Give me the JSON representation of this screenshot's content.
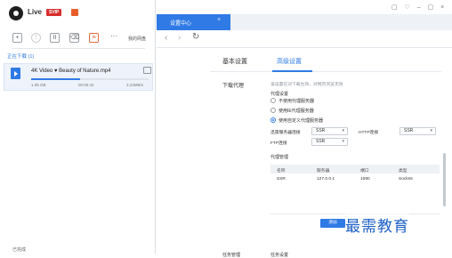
{
  "app": {
    "name": "Live",
    "badge": "SVIP"
  },
  "toolbar": {
    "more": "···",
    "my_downloads": "我的网盘"
  },
  "sidebar": {
    "downloading_tab": "正在下载 (1)",
    "completed_tab": "已完成",
    "task": {
      "name": "4K Video ♥ Beauty of Nature.mp4",
      "progress": 0.42,
      "size": "1.05 GB",
      "time": "00:05:42",
      "speed": "3.23MB/s"
    }
  },
  "browser": {
    "tab_title": "设置中心",
    "tab_close": "×",
    "win_ctrls": "▢ ♡ – ▢ ×"
  },
  "settings": {
    "tabs": [
      "基本设置",
      "高级设置"
    ],
    "active_tab": 1,
    "section_title": "下载代理",
    "section_desc": "该设置仅对下载生效，对网页浏览无效",
    "proxy_settings_label": "代理设置",
    "radio_options": [
      "不使用代理服务器",
      "使用IE代理服务器",
      "使用自定义代理服务器"
    ],
    "radio_selected": 2,
    "xunlei_label": "迅雷服务器连接",
    "xunlei_value": "SSR",
    "http_label": "HTTP连接",
    "http_value": "SSR",
    "ftp_label": "FTP连接",
    "ftp_value": "SSR",
    "mgmt_label": "代理管理",
    "table": {
      "columns": [
        "名称",
        "服务器",
        "端口",
        "类型"
      ],
      "rows": [
        [
          "SSR",
          "127.0.0.1",
          "1080",
          "Socks5"
        ]
      ]
    },
    "add_button": "添加",
    "bottom_label": "任务管理",
    "bottom_label_2": "任务设置"
  },
  "watermark": "最需教育"
}
